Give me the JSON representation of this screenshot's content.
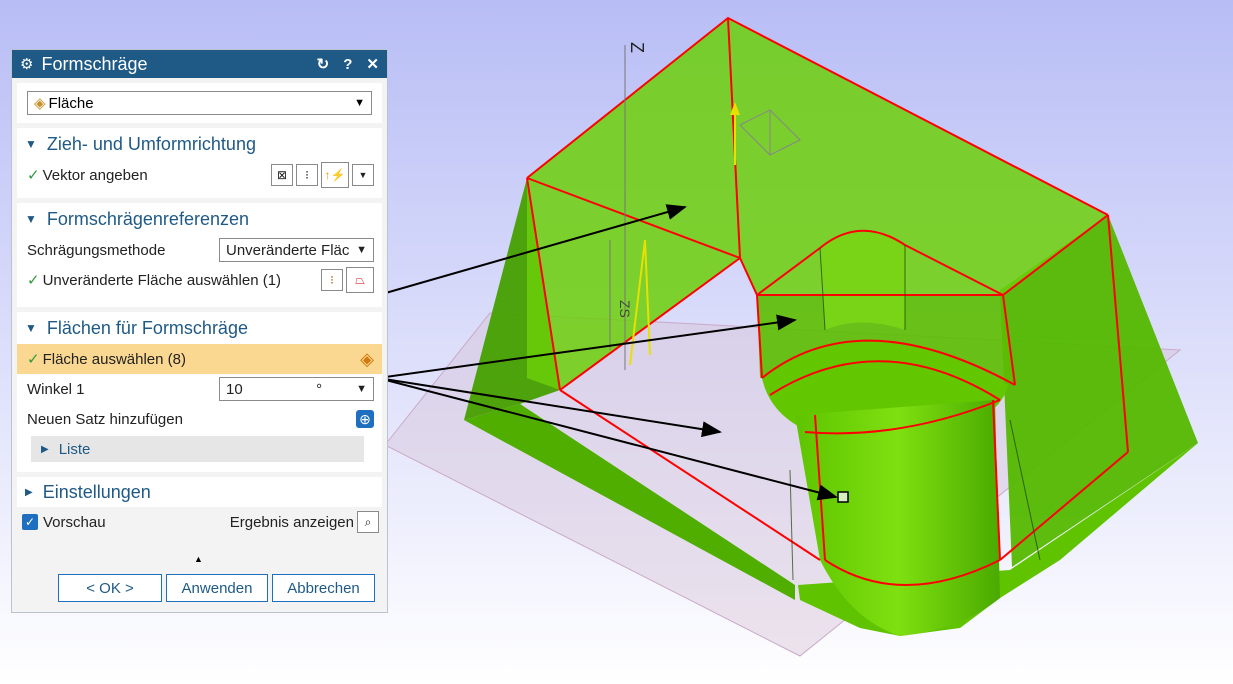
{
  "dialog": {
    "title": "Formschräge",
    "reset_icon": "↻",
    "help_label": "?",
    "close_label": "✕",
    "type_select": "Fläche",
    "sections": {
      "direction": {
        "title": "Zieh- und Umformrichtung",
        "vector_label": "Vektor angeben"
      },
      "references": {
        "title": "Formschrägenreferenzen",
        "method_label": "Schrägungsmethode",
        "method_value": "Unveränderte Fläc",
        "face_label": "Unveränderte Fläche auswählen (1)"
      },
      "faces": {
        "title": "Flächen für Formschräge",
        "select_label": "Fläche auswählen (8)",
        "angle_label": "Winkel 1",
        "angle_value": "10",
        "angle_unit": "°",
        "add_set_label": "Neuen Satz hinzufügen",
        "list_label": "Liste"
      },
      "settings": {
        "title": "Einstellungen"
      }
    },
    "preview_label": "Vorschau",
    "show_result_label": "Ergebnis anzeigen",
    "buttons": {
      "ok": "< OK >",
      "apply": "Anwenden",
      "cancel": "Abbrechen"
    }
  },
  "viewport": {
    "dimension_label_1": "Z",
    "dimension_label_2": "ZS",
    "colors": {
      "body": "#52b800",
      "edges": "#ff0000",
      "background_top": "#b8bdf5"
    }
  }
}
